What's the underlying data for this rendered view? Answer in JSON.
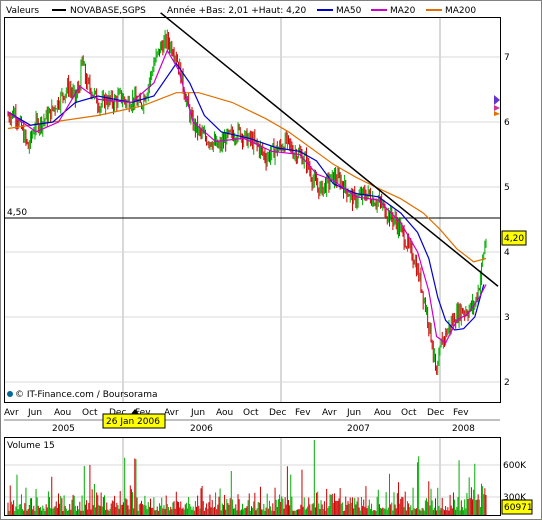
{
  "chart_data": {
    "type": "candlestick",
    "legend": {
      "label": "Valeurs",
      "items": [
        {
          "name": "NOVABASE,SGPS",
          "color": "#000000"
        },
        {
          "name": "MA50",
          "color": "#0000cc"
        },
        {
          "name": "MA20",
          "color": "#cc00cc"
        },
        {
          "name": "MA200",
          "color": "#e07000"
        }
      ],
      "stats": "Année +Bas: 2,01 +Haut: 4,20"
    },
    "y_ticks": [
      2,
      3,
      4,
      5,
      6,
      7
    ],
    "y_tick_labels": [
      "2",
      "3",
      "4",
      "5",
      "6",
      "7"
    ],
    "ylim": [
      1.8,
      7.7
    ],
    "x_month_labels": [
      "Avr",
      "Jun",
      "Aou",
      "Oct",
      "Dec",
      "Fev",
      "Avr",
      "Jun",
      "Aou",
      "Oct",
      "Dec",
      "Fev",
      "Avr",
      "Jun",
      "Aou",
      "Oct",
      "Dec",
      "Fev"
    ],
    "x_year_labels": [
      "2005",
      "2006",
      "2007",
      "2008"
    ],
    "reference_line": {
      "label": "4,50",
      "value": 4.5
    },
    "last_price_label": "4,20",
    "last_price": 4.2,
    "date_marker": "26 Jan 2006",
    "source": "© IT-Finance.com / Boursorama",
    "grid": true,
    "price_points": [
      [
        0,
        6.1
      ],
      [
        6,
        6.15
      ],
      [
        12,
        5.9
      ],
      [
        18,
        5.6
      ],
      [
        24,
        5.95
      ],
      [
        30,
        6.0
      ],
      [
        36,
        6.1
      ],
      [
        42,
        6.25
      ],
      [
        48,
        6.4
      ],
      [
        54,
        6.55
      ],
      [
        60,
        6.35
      ],
      [
        64,
        6.6
      ],
      [
        66,
        6.95
      ],
      [
        70,
        6.6
      ],
      [
        76,
        6.45
      ],
      [
        82,
        6.25
      ],
      [
        88,
        6.35
      ],
      [
        94,
        6.3
      ],
      [
        100,
        6.4
      ],
      [
        106,
        6.3
      ],
      [
        112,
        6.35
      ],
      [
        118,
        6.25
      ],
      [
        124,
        6.5
      ],
      [
        130,
        6.9
      ],
      [
        136,
        7.15
      ],
      [
        142,
        7.25
      ],
      [
        148,
        7.1
      ],
      [
        152,
        6.9
      ],
      [
        158,
        6.4
      ],
      [
        164,
        6.0
      ],
      [
        170,
        5.85
      ],
      [
        176,
        5.75
      ],
      [
        182,
        5.7
      ],
      [
        188,
        5.6
      ],
      [
        194,
        5.75
      ],
      [
        200,
        5.8
      ],
      [
        206,
        5.85
      ],
      [
        212,
        5.75
      ],
      [
        218,
        5.7
      ],
      [
        224,
        5.6
      ],
      [
        230,
        5.45
      ],
      [
        236,
        5.55
      ],
      [
        242,
        5.6
      ],
      [
        248,
        5.7
      ],
      [
        254,
        5.55
      ],
      [
        260,
        5.5
      ],
      [
        266,
        5.4
      ],
      [
        272,
        5.1
      ],
      [
        278,
        4.95
      ],
      [
        284,
        5.05
      ],
      [
        290,
        5.15
      ],
      [
        296,
        5.1
      ],
      [
        302,
        4.95
      ],
      [
        308,
        4.8
      ],
      [
        314,
        4.85
      ],
      [
        320,
        4.9
      ],
      [
        326,
        4.8
      ],
      [
        332,
        4.75
      ],
      [
        338,
        4.6
      ],
      [
        344,
        4.5
      ],
      [
        350,
        4.35
      ],
      [
        356,
        4.1
      ],
      [
        362,
        3.9
      ],
      [
        368,
        3.5
      ],
      [
        374,
        3.0
      ],
      [
        378,
        2.6
      ],
      [
        382,
        2.05
      ],
      [
        386,
        2.6
      ],
      [
        392,
        2.8
      ],
      [
        398,
        3.0
      ],
      [
        404,
        3.1
      ],
      [
        410,
        3.1
      ],
      [
        416,
        3.2
      ],
      [
        420,
        3.5
      ],
      [
        424,
        4.0
      ],
      [
        426,
        4.2
      ]
    ],
    "ma200_points": [
      [
        0,
        5.9
      ],
      [
        40,
        6.0
      ],
      [
        80,
        6.1
      ],
      [
        120,
        6.25
      ],
      [
        150,
        6.45
      ],
      [
        170,
        6.45
      ],
      [
        200,
        6.3
      ],
      [
        230,
        6.05
      ],
      [
        250,
        5.85
      ],
      [
        270,
        5.6
      ],
      [
        290,
        5.35
      ],
      [
        310,
        5.15
      ],
      [
        330,
        4.98
      ],
      [
        350,
        4.82
      ],
      [
        370,
        4.6
      ],
      [
        385,
        4.35
      ],
      [
        400,
        4.05
      ],
      [
        415,
        3.85
      ],
      [
        426,
        3.9
      ]
    ],
    "ma50_points": [
      [
        0,
        6.15
      ],
      [
        20,
        5.95
      ],
      [
        40,
        6.0
      ],
      [
        60,
        6.3
      ],
      [
        80,
        6.4
      ],
      [
        110,
        6.3
      ],
      [
        130,
        6.4
      ],
      [
        150,
        6.9
      ],
      [
        162,
        6.6
      ],
      [
        175,
        6.1
      ],
      [
        190,
        5.85
      ],
      [
        215,
        5.75
      ],
      [
        240,
        5.6
      ],
      [
        260,
        5.55
      ],
      [
        275,
        5.4
      ],
      [
        290,
        5.05
      ],
      [
        310,
        4.9
      ],
      [
        330,
        4.85
      ],
      [
        350,
        4.6
      ],
      [
        365,
        4.3
      ],
      [
        375,
        3.9
      ],
      [
        383,
        3.3
      ],
      [
        390,
        2.95
      ],
      [
        398,
        2.8
      ],
      [
        406,
        2.82
      ],
      [
        416,
        3.0
      ],
      [
        424,
        3.5
      ]
    ],
    "ma20_points": [
      [
        0,
        6.15
      ],
      [
        25,
        5.85
      ],
      [
        45,
        6.0
      ],
      [
        64,
        6.55
      ],
      [
        80,
        6.35
      ],
      [
        110,
        6.3
      ],
      [
        130,
        6.6
      ],
      [
        142,
        7.1
      ],
      [
        152,
        6.8
      ],
      [
        165,
        6.0
      ],
      [
        185,
        5.7
      ],
      [
        210,
        5.75
      ],
      [
        235,
        5.55
      ],
      [
        260,
        5.5
      ],
      [
        275,
        5.2
      ],
      [
        290,
        5.1
      ],
      [
        310,
        4.85
      ],
      [
        330,
        4.8
      ],
      [
        350,
        4.45
      ],
      [
        365,
        4.0
      ],
      [
        375,
        3.4
      ],
      [
        382,
        2.7
      ],
      [
        390,
        2.6
      ],
      [
        400,
        2.95
      ],
      [
        410,
        3.05
      ],
      [
        420,
        3.3
      ],
      [
        426,
        3.5
      ]
    ],
    "trendline": {
      "from": [
        136,
        7.68
      ],
      "to": [
        426,
        3.55
      ]
    },
    "volume": {
      "label": "Volume 15",
      "ticks": [
        "600K",
        "300K"
      ],
      "last_volume": "60971"
    }
  }
}
